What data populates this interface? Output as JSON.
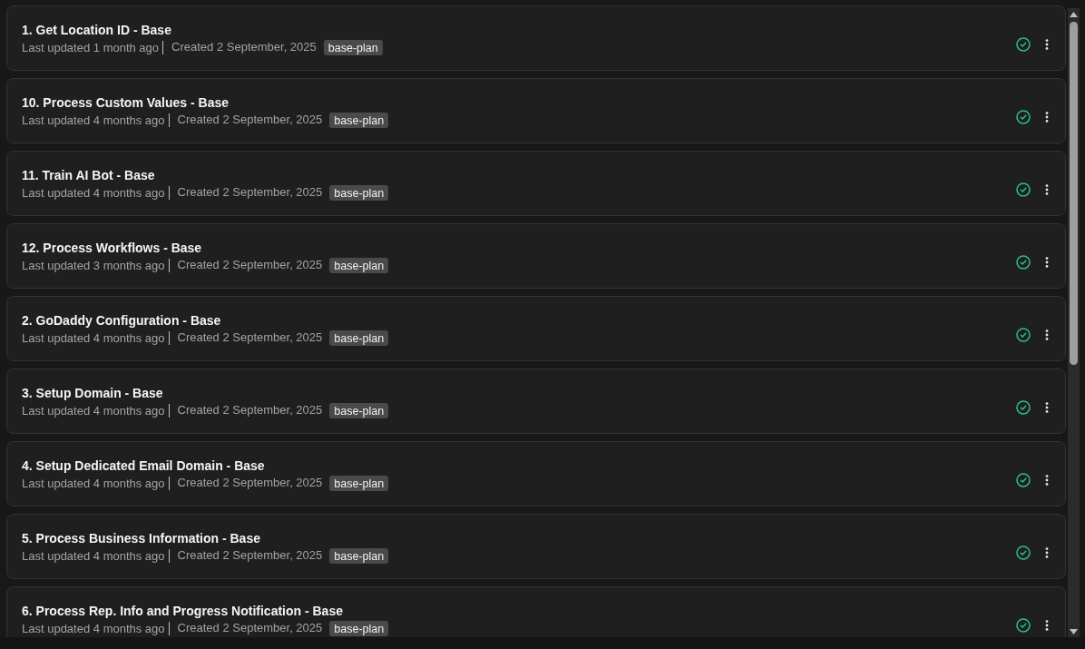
{
  "items": [
    {
      "title": "1. Get Location ID - Base",
      "updated": "Last updated 1 month ago",
      "created": "Created 2 September, 2025",
      "tags": [
        "base-plan"
      ],
      "complete": true
    },
    {
      "title": "10. Process Custom Values - Base",
      "updated": "Last updated 4 months ago",
      "created": "Created 2 September, 2025",
      "tags": [
        "base-plan"
      ],
      "complete": true
    },
    {
      "title": "11. Train AI Bot - Base",
      "updated": "Last updated 4 months ago",
      "created": "Created 2 September, 2025",
      "tags": [
        "base-plan"
      ],
      "complete": true
    },
    {
      "title": "12. Process Workflows - Base",
      "updated": "Last updated 3 months ago",
      "created": "Created 2 September, 2025",
      "tags": [
        "base-plan"
      ],
      "complete": true
    },
    {
      "title": "2. GoDaddy Configuration - Base",
      "updated": "Last updated 4 months ago",
      "created": "Created 2 September, 2025",
      "tags": [
        "base-plan"
      ],
      "complete": true
    },
    {
      "title": "3. Setup Domain - Base",
      "updated": "Last updated 4 months ago",
      "created": "Created 2 September, 2025",
      "tags": [
        "base-plan"
      ],
      "complete": true
    },
    {
      "title": "4. Setup Dedicated Email Domain - Base",
      "updated": "Last updated 4 months ago",
      "created": "Created 2 September, 2025",
      "tags": [
        "base-plan"
      ],
      "complete": true
    },
    {
      "title": "5. Process Business Information - Base",
      "updated": "Last updated 4 months ago",
      "created": "Created 2 September, 2025",
      "tags": [
        "base-plan"
      ],
      "complete": true
    },
    {
      "title": "6. Process Rep. Info and Progress Notification - Base",
      "updated": "Last updated 4 months ago",
      "created": "Created 2 September, 2025",
      "tags": [
        "base-plan"
      ],
      "complete": true
    }
  ]
}
